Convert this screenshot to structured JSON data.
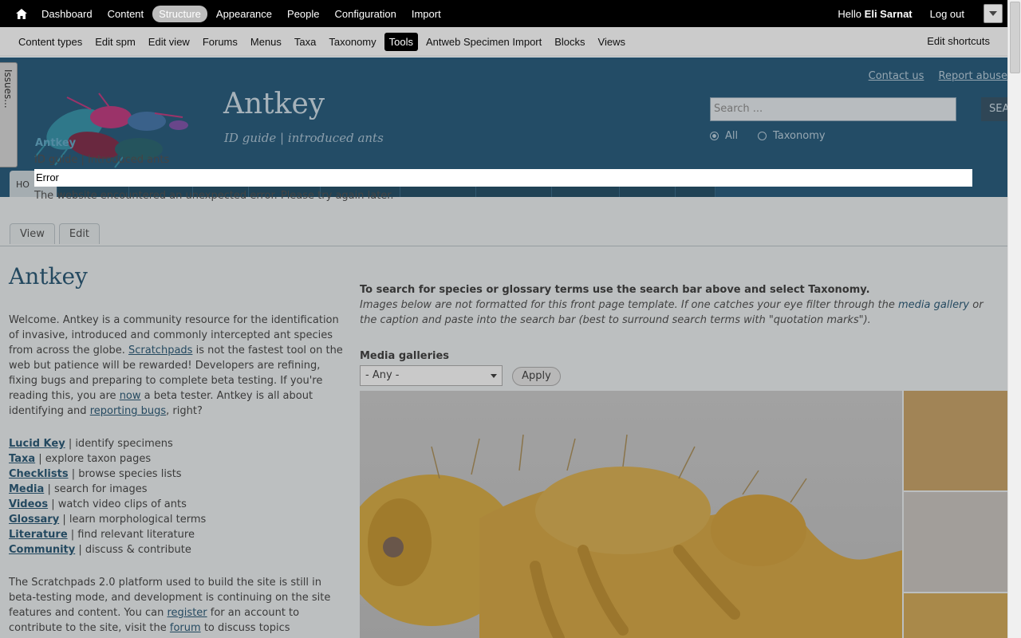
{
  "toolbar": {
    "items": [
      {
        "label": "Dashboard"
      },
      {
        "label": "Content"
      },
      {
        "label": "Structure"
      },
      {
        "label": "Appearance"
      },
      {
        "label": "People"
      },
      {
        "label": "Configuration"
      },
      {
        "label": "Import"
      }
    ],
    "active": "Structure",
    "hello_prefix": "Hello",
    "user_name": "Eli Sarnat",
    "logout": "Log out",
    "shortcuts": [
      {
        "label": "Content types"
      },
      {
        "label": "Edit spm"
      },
      {
        "label": "Edit view"
      },
      {
        "label": "Forums"
      },
      {
        "label": "Menus"
      },
      {
        "label": "Taxa"
      },
      {
        "label": "Taxonomy"
      },
      {
        "label": "Tools"
      },
      {
        "label": "Antweb Specimen Import"
      },
      {
        "label": "Blocks"
      },
      {
        "label": "Views"
      }
    ],
    "active_shortcut": "Tools",
    "edit_shortcuts": "Edit shortcuts"
  },
  "issues_tab": "Issues...",
  "header": {
    "site_name": "Antkey",
    "slogan": "ID guide | introduced ants",
    "logo_caption": "Antkey",
    "links": [
      "Contact us",
      "Report abuse"
    ],
    "search_placeholder": "Search ...",
    "search_button": "SEA",
    "radio_all": "All",
    "radio_taxonomy": "Taxonomy",
    "first_nav_tab": "HO"
  },
  "overlay": {
    "logo_subtext": "ID guide | Introduced ants",
    "error_title": "Error",
    "error_message": "The website encountered an unexpected error. Please try again later."
  },
  "tabs": [
    "View",
    "Edit"
  ],
  "page_title": "Antkey",
  "intro": {
    "p1": "Welcome. Antkey is a community resource for the identification of invasive, introduced and commonly intercepted ant species from across the globe.",
    "scratchpads": "Scratchpads",
    "p1b": "is not the fastest tool on the web but patience will be rewarded! Developers are refining, fixing bugs and preparing to complete beta testing. If you're reading this, you are",
    "now": "now",
    "p1c": "a beta tester. Antkey is all about identifying and",
    "reporting_bugs": "reporting bugs",
    "p1d": ", right?"
  },
  "links": [
    {
      "label": "Lucid Key",
      "desc": "| identify specimens"
    },
    {
      "label": "Taxa",
      "desc": "| explore taxon pages"
    },
    {
      "label": "Checklists",
      "desc": "| browse species lists"
    },
    {
      "label": "Media",
      "desc": "| search for images"
    },
    {
      "label": "Videos",
      "desc": "| watch video clips of ants"
    },
    {
      "label": "Glossary",
      "desc": "| learn morphological terms"
    },
    {
      "label": "Literature",
      "desc": "| find relevant literature"
    },
    {
      "label": "Community",
      "desc": "| discuss & contribute"
    }
  ],
  "footer_text": {
    "a": "The Scratchpads 2.0 platform used to build the site is still in beta-testing mode, and development is continuing on the site features and content. You can",
    "register": "register",
    "b": "for an account to contribute to the site, visit the",
    "forum": "forum",
    "c": "to discuss  topics"
  },
  "right": {
    "lead": "To search for species or glossary terms use the search bar above and select Taxonomy.",
    "note1": "Images below are not formatted for this front page template. If one catches your eye filter through the",
    "media_gallery": "media gallery",
    "note1_end": "or",
    "note2": "the caption and paste into the search bar (best to surround search terms with \"quotation marks\").",
    "media_galleries_label": "Media galleries",
    "select_value": "- Any -",
    "apply": "Apply"
  }
}
